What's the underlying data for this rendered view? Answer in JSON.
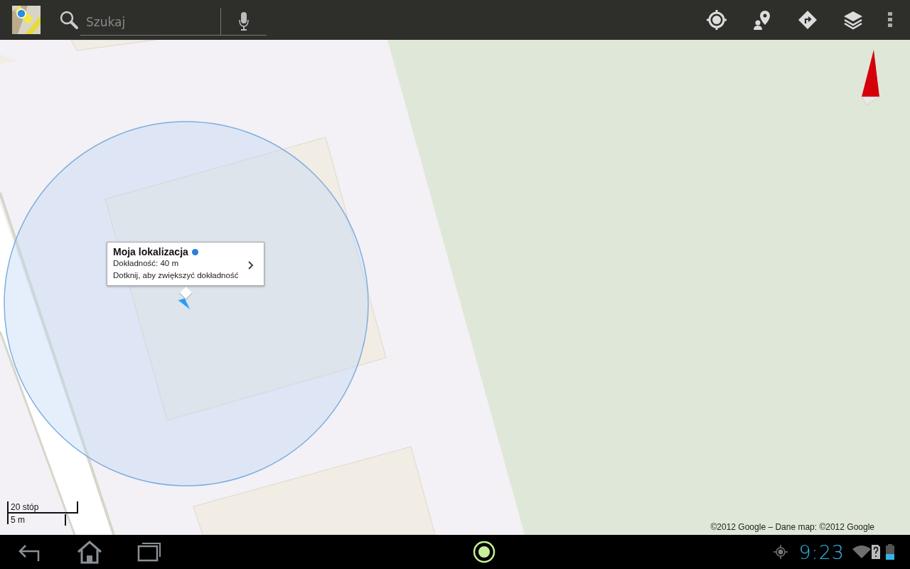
{
  "search": {
    "placeholder": "Szukaj"
  },
  "info_bubble": {
    "title": "Moja lokalizacja",
    "accuracy": "Dokładność: 40 m",
    "hint": "Dotknij, aby zwiększyć dokładność"
  },
  "scale": {
    "imperial": "20 stóp",
    "metric": "5 m"
  },
  "copyright": "©2012 Google – Dane map: ©2012 Google",
  "status_bar": {
    "time": "9:23"
  }
}
